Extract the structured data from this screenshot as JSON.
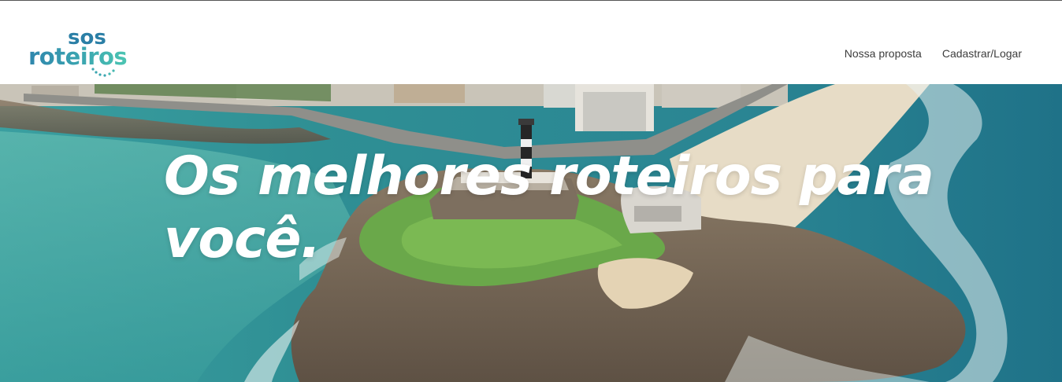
{
  "brand": {
    "logo_line1": "sos",
    "logo_line2": "roteiros"
  },
  "nav": {
    "items": [
      {
        "label": "Nossa proposta"
      },
      {
        "label": "Cadastrar/Logar"
      }
    ]
  },
  "hero": {
    "headline": "Os melhores roteiros para você.",
    "image_description": "aerial coastal view with fort and lighthouse"
  },
  "colors": {
    "brand_blue": "#2b7fa6",
    "brand_teal": "#4cc5b2",
    "nav_text": "#3d3d3d",
    "headline": "#ffffff"
  }
}
